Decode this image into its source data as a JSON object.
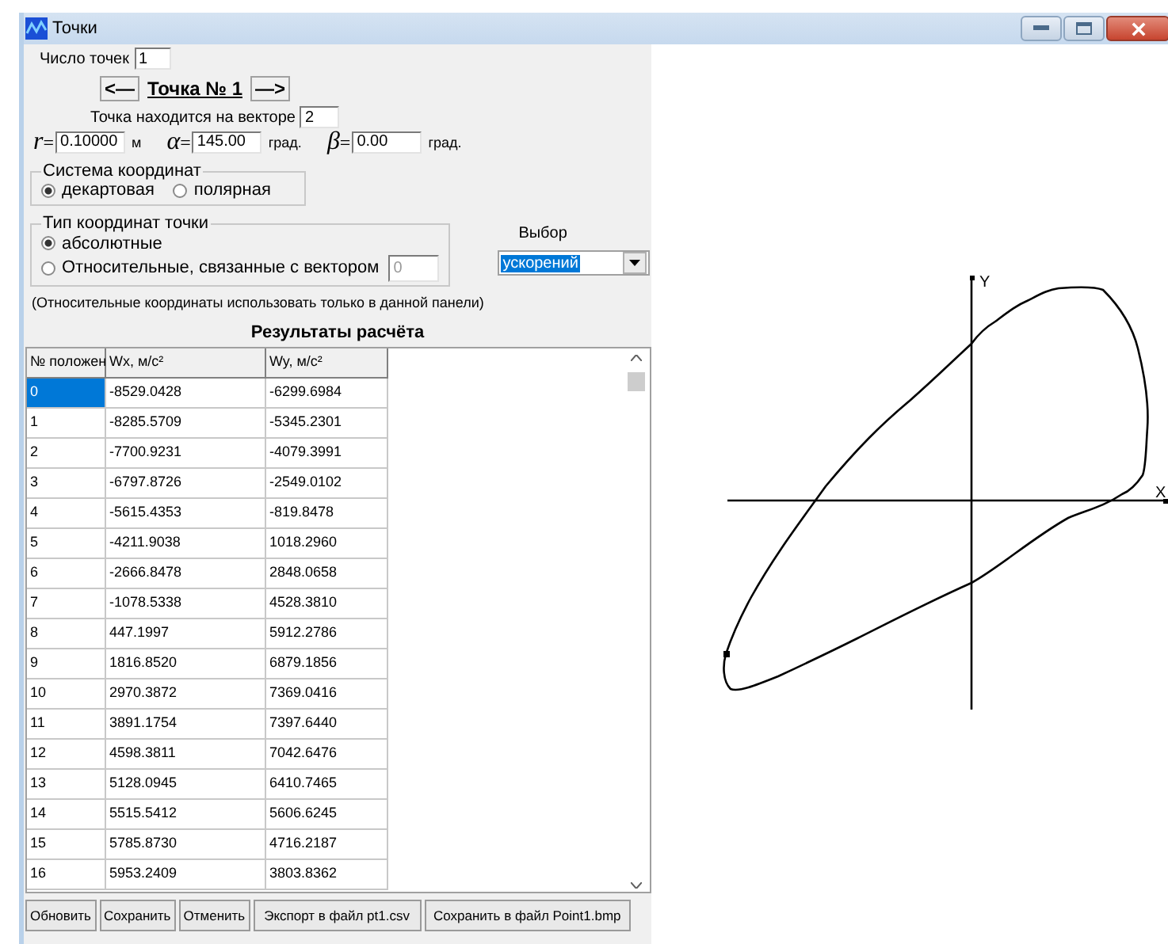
{
  "window": {
    "title": "Точки"
  },
  "count": {
    "label": "Число точек",
    "value": "1"
  },
  "navigator": {
    "prev": "<—",
    "title": "Точка № 1",
    "next": "—>"
  },
  "vector": {
    "label": "Точка находится на векторе",
    "value": "2"
  },
  "params": [
    {
      "symbol": "r",
      "eq": "=",
      "value": "0.10000",
      "unit": "м"
    },
    {
      "symbol": "α",
      "eq": "=",
      "value": "145.00",
      "unit": "град."
    },
    {
      "symbol": "β",
      "eq": "=",
      "value": "0.00",
      "unit": "град."
    }
  ],
  "coord_system": {
    "title": "Система координат",
    "options": [
      {
        "label": "декартовая",
        "selected": true
      },
      {
        "label": "полярная",
        "selected": false
      }
    ]
  },
  "point_type": {
    "title": "Тип координат точки",
    "options": [
      {
        "label": "абсолютные",
        "selected": true
      },
      {
        "label": "Относительные, связанные с вектором",
        "selected": false
      }
    ],
    "vector_field": {
      "value": "0",
      "disabled": true
    }
  },
  "note": "(Относительные координаты использовать только в данной панели)",
  "choice": {
    "label": "Выбор",
    "value": "ускорений"
  },
  "results": {
    "title": "Результаты расчёта",
    "columns": [
      "№ положен",
      "Wx, м/с²",
      "Wy, м/с²"
    ],
    "rows": [
      {
        "cells": [
          "0",
          "-8529.0428",
          "-6299.6984"
        ],
        "selected": true
      },
      {
        "cells": [
          "1",
          "-8285.5709",
          "-5345.2301"
        ],
        "selected": false
      },
      {
        "cells": [
          "2",
          "-7700.9231",
          "-4079.3991"
        ],
        "selected": false
      },
      {
        "cells": [
          "3",
          "-6797.8726",
          "-2549.0102"
        ],
        "selected": false
      },
      {
        "cells": [
          "4",
          "-5615.4353",
          "-819.8478"
        ],
        "selected": false
      },
      {
        "cells": [
          "5",
          "-4211.9038",
          "1018.2960"
        ],
        "selected": false
      },
      {
        "cells": [
          "6",
          "-2666.8478",
          "2848.0658"
        ],
        "selected": false
      },
      {
        "cells": [
          "7",
          "-1078.5338",
          "4528.3810"
        ],
        "selected": false
      },
      {
        "cells": [
          "8",
          "447.1997",
          "5912.2786"
        ],
        "selected": false
      },
      {
        "cells": [
          "9",
          "1816.8520",
          "6879.1856"
        ],
        "selected": false
      },
      {
        "cells": [
          "10",
          "2970.3872",
          "7369.0416"
        ],
        "selected": false
      },
      {
        "cells": [
          "11",
          "3891.1754",
          "7397.6440"
        ],
        "selected": false
      },
      {
        "cells": [
          "12",
          "4598.3811",
          "7042.6476"
        ],
        "selected": false
      },
      {
        "cells": [
          "13",
          "5128.0945",
          "6410.7465"
        ],
        "selected": false
      },
      {
        "cells": [
          "14",
          "5515.5412",
          "5606.6245"
        ],
        "selected": false
      },
      {
        "cells": [
          "15",
          "5785.8730",
          "4716.2187"
        ],
        "selected": false
      },
      {
        "cells": [
          "16",
          "5953.2409",
          "3803.8362"
        ],
        "selected": false
      }
    ]
  },
  "buttons": [
    "Обновить",
    "Сохранить",
    "Отменить",
    "Экспорт в файл pt1.csv",
    "Сохранить в файл Point1.bmp"
  ],
  "plot": {
    "x_label": "X",
    "y_label": "Y"
  }
}
